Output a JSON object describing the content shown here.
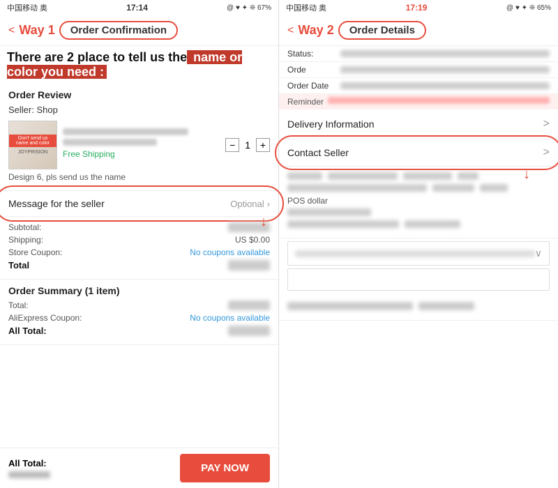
{
  "left": {
    "status_bar": {
      "carrier": "中国移动 奥",
      "time": "17:14",
      "icons": "@ ♥ ✦ ❊ 67%"
    },
    "nav": {
      "back": "<",
      "way_label": "Way 1",
      "title": "Order Confirmation"
    },
    "overlay": {
      "black_text": "There are 2 place to tell us the",
      "red_text": " name or color you need :"
    },
    "order_review": {
      "title": "Order Review",
      "seller_label": "Seller:  Shop"
    },
    "product": {
      "free_shipping": "Free Shipping",
      "quantity": "1",
      "design_note": "Design 6, pls send us the name"
    },
    "message": {
      "label": "Message for the seller",
      "optional": "Optional"
    },
    "costs": {
      "subtotal_label": "Subtotal:",
      "shipping_label": "Shipping:",
      "shipping_value": "US $0.00",
      "coupon_label": "Store Coupon:",
      "coupon_value": "No coupons available",
      "total_label": "Total"
    },
    "order_summary": {
      "title": "Order Summary (1 item)",
      "total_label": "Total:",
      "aliexpress_label": "AliExpress Coupon:",
      "aliexpress_value": "No coupons available",
      "all_total_label": "All Total:"
    },
    "bottom": {
      "all_total": "All Total:",
      "pay_now": "PAY NOW"
    }
  },
  "right": {
    "status_bar": {
      "carrier": "中国移动 奥",
      "time": "17:19",
      "icons": "@ ♥ ✦ ❊ 65%"
    },
    "nav": {
      "back": "<",
      "way_label": "Way 2",
      "title": "Order Details"
    },
    "status_label": "Status:",
    "order_label": "Orde",
    "order_date_label": "Order Date",
    "reminder_label": "Reminder",
    "delivery": {
      "label": "Delivery Information",
      "chevron": ">"
    },
    "contact": {
      "label": "Contact Seller",
      "chevron": ">"
    },
    "pos_dollar": "POS dollar"
  }
}
